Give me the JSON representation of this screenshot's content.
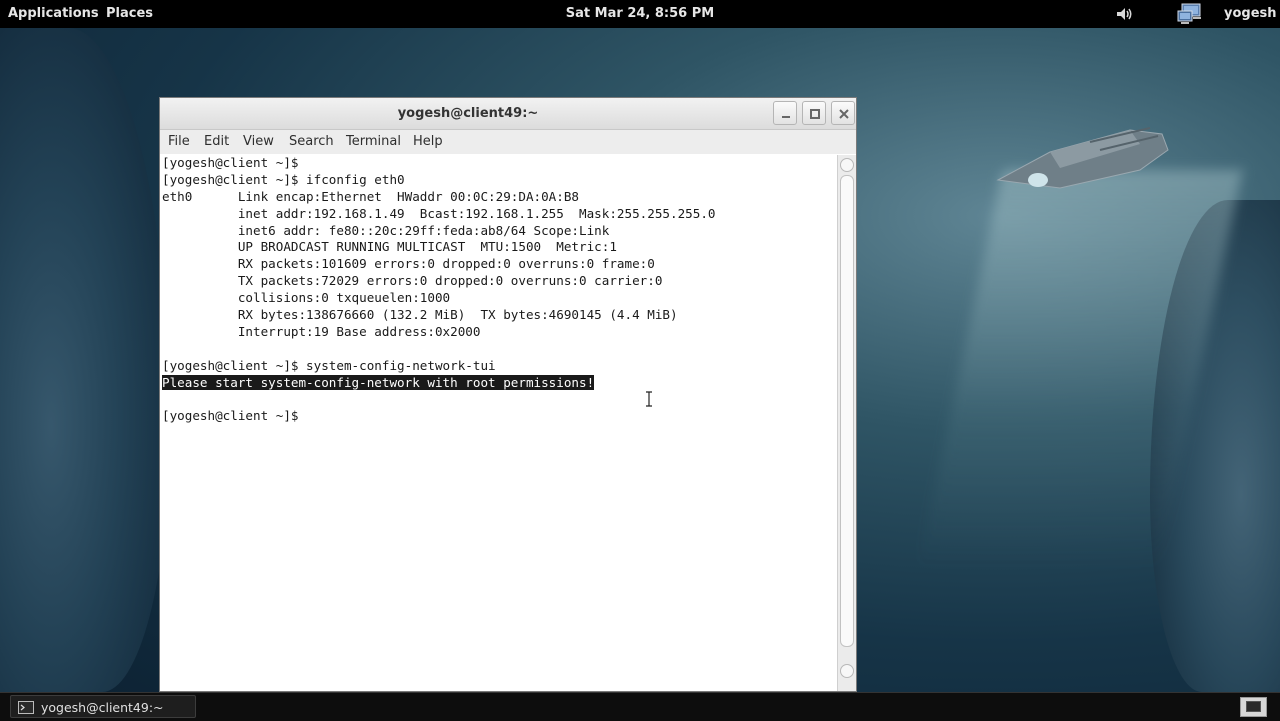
{
  "top_panel": {
    "applications": "Applications",
    "places": "Places",
    "clock": "Sat Mar 24,  8:56 PM",
    "user": "yogesh",
    "icons": [
      "volume-icon",
      "network-icon"
    ]
  },
  "window": {
    "title": "yogesh@client49:~",
    "menu": [
      "File",
      "Edit",
      "View",
      "Search",
      "Terminal",
      "Help"
    ],
    "terminal_lines": [
      "[yogesh@client ~]$",
      "[yogesh@client ~]$ ifconfig eth0",
      "eth0      Link encap:Ethernet  HWaddr 00:0C:29:DA:0A:B8",
      "          inet addr:192.168.1.49  Bcast:192.168.1.255  Mask:255.255.255.0",
      "          inet6 addr: fe80::20c:29ff:feda:ab8/64 Scope:Link",
      "          UP BROADCAST RUNNING MULTICAST  MTU:1500  Metric:1",
      "          RX packets:101609 errors:0 dropped:0 overruns:0 frame:0",
      "          TX packets:72029 errors:0 dropped:0 overruns:0 carrier:0",
      "          collisions:0 txqueuelen:1000",
      "          RX bytes:138676660 (132.2 MiB)  TX bytes:4690145 (4.4 MiB)",
      "          Interrupt:19 Base address:0x2000",
      "",
      "[yogesh@client ~]$ system-config-network-tui",
      "Please start system-config-network with root permissions!",
      "",
      "[yogesh@client ~]$ "
    ],
    "highlighted_line": "Please start system-config-network with root permissions!"
  },
  "taskbar": {
    "task_label": "yogesh@client49:~"
  }
}
